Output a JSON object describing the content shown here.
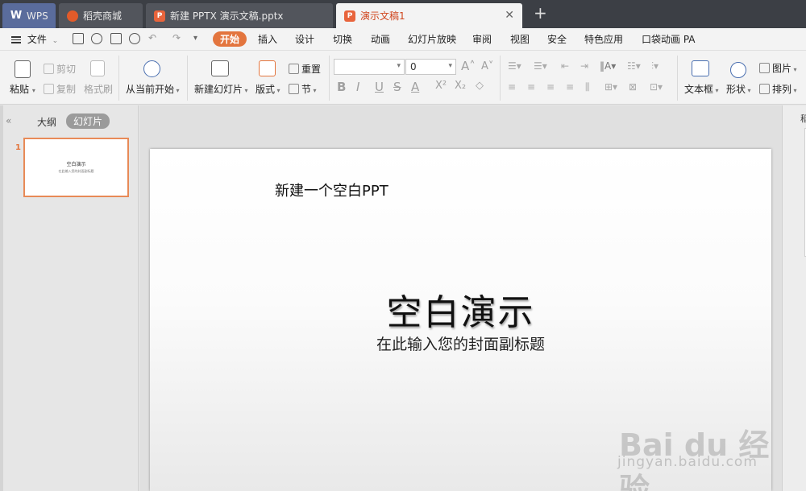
{
  "tabs": {
    "wps": "WPS",
    "store": "稻壳商城",
    "file1": "新建 PPTX 演示文稿.pptx",
    "active": "演示文稿1"
  },
  "menu": {
    "file": "文件",
    "items": [
      "开始",
      "插入",
      "设计",
      "切换",
      "动画",
      "幻灯片放映",
      "审阅",
      "视图",
      "安全",
      "特色应用",
      "口袋动画 PA"
    ]
  },
  "ribbon": {
    "paste": "粘贴",
    "cut": "剪切",
    "copy": "复制",
    "format_painter": "格式刷",
    "from_current": "从当前开始",
    "new_slide": "新建幻灯片",
    "layout": "版式",
    "reset": "重置",
    "section": "节",
    "font_size": "0",
    "textbox": "文本框",
    "shape": "形状",
    "picture": "图片",
    "arrange": "排列"
  },
  "left_panel": {
    "outline_tab": "大纲",
    "slides_tab": "幻灯片",
    "slide_number": "1",
    "thumb_title": "空白演示",
    "thumb_subtitle": "在此输入您的封面副标题"
  },
  "slide": {
    "note": "新建一个空白PPT",
    "title": "空白演示",
    "subtitle": "在此输入您的封面副标题"
  },
  "right_panel": {
    "label": "稻"
  },
  "watermark": {
    "brand": "Bai du 经验",
    "url": "jingyan.baidu.com"
  },
  "colors": {
    "accent": "#e3753e",
    "tabbar": "#3c3f45",
    "wps_tab": "#5a6c9c"
  }
}
